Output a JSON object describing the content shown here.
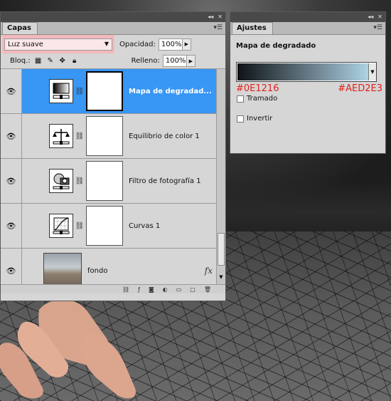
{
  "capas_panel": {
    "tab_label": "Capas",
    "blend_mode": "Luz suave",
    "opacity_label": "Opacidad:",
    "opacity_value": "100%",
    "lock_label": "Bloq.:",
    "fill_label": "Relleno:",
    "fill_value": "100%",
    "layers": [
      {
        "name": "Mapa de degradad...",
        "selected": true,
        "icon": "gradient-map-icon"
      },
      {
        "name": "Equilibrio de color 1",
        "selected": false,
        "icon": "balance-scale-icon"
      },
      {
        "name": "Filtro de fotografía 1",
        "selected": false,
        "icon": "photo-filter-icon"
      },
      {
        "name": "Curvas 1",
        "selected": false,
        "icon": "curves-icon"
      },
      {
        "name": "fondo",
        "selected": false,
        "icon": "image-thumbnail"
      }
    ],
    "fx_label": "fx"
  },
  "ajustes_panel": {
    "tab_label": "Ajustes",
    "title": "Mapa de degradado",
    "gradient_start": "#0E1216",
    "gradient_end": "#AED2E3",
    "hex_start_label": "#0E1216",
    "hex_end_label": "#AED2E3",
    "tramado_label": "Tramado",
    "invertir_label": "Invertir"
  },
  "colors": {
    "selection": "#3896f4",
    "annotation_red": "#e0211c",
    "blend_highlight": "#f2b8bb"
  }
}
